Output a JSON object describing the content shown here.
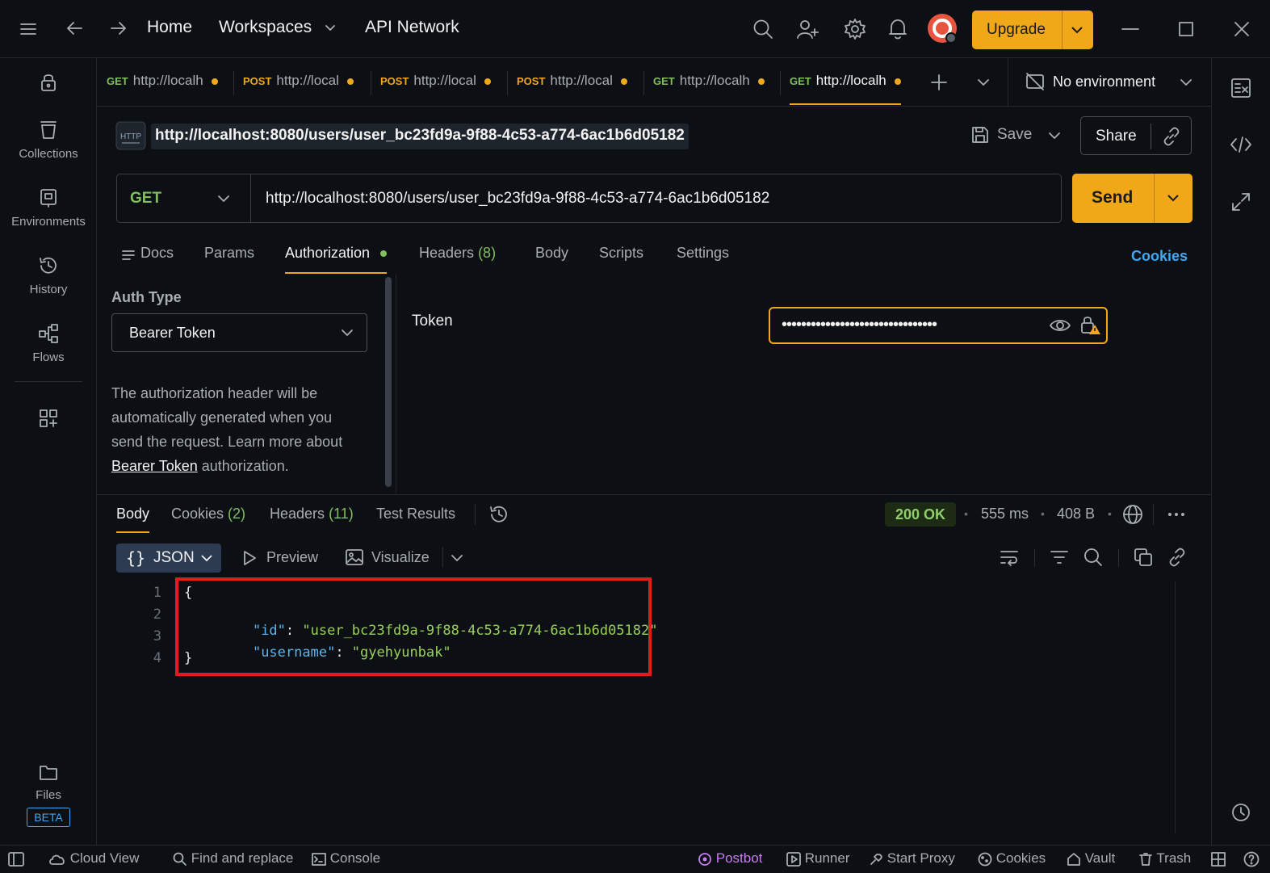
{
  "titlebar": {
    "home": "Home",
    "workspaces": "Workspaces",
    "api_network": "API Network",
    "upgrade": "Upgrade"
  },
  "sidebar": {
    "items": [
      {
        "label": "Collections"
      },
      {
        "label": "Environments"
      },
      {
        "label": "History"
      },
      {
        "label": "Flows"
      }
    ],
    "files": "Files",
    "beta": "BETA"
  },
  "tabs": [
    {
      "method": "GET",
      "url": "http://localh"
    },
    {
      "method": "POST",
      "url": "http://local"
    },
    {
      "method": "POST",
      "url": "http://local"
    },
    {
      "method": "POST",
      "url": "http://local"
    },
    {
      "method": "GET",
      "url": "http://localh"
    },
    {
      "method": "GET",
      "url": "http://localh"
    }
  ],
  "environment": "No environment",
  "request": {
    "name": "http://localhost:8080/users/user_bc23fd9a-9f88-4c53-a774-6ac1b6d05182",
    "save": "Save",
    "share": "Share",
    "method": "GET",
    "url": "http://localhost:8080/users/user_bc23fd9a-9f88-4c53-a774-6ac1b6d05182",
    "send": "Send",
    "tabs": {
      "docs": "Docs",
      "params": "Params",
      "authorization": "Authorization",
      "headers": "Headers",
      "headers_count": "(8)",
      "body": "Body",
      "scripts": "Scripts",
      "settings": "Settings"
    },
    "cookies": "Cookies"
  },
  "auth": {
    "type_label": "Auth Type",
    "type_value": "Bearer Token",
    "help_line1": "The authorization header will be",
    "help_line2": "automatically generated when you",
    "help_line3": "send the request. Learn more about",
    "help_link": "Bearer Token",
    "help_tail": " authorization.",
    "token_label": "Token",
    "token_masked": "••••••••••••••••••••••••••••••••"
  },
  "response": {
    "tabs": {
      "body": "Body",
      "cookies": "Cookies",
      "cookies_count": "(2)",
      "headers": "Headers",
      "headers_count": "(11)",
      "test_results": "Test Results"
    },
    "status": "200 OK",
    "time": "555 ms",
    "size": "408 B",
    "format": "JSON",
    "preview": "Preview",
    "visualize": "Visualize",
    "lines": [
      {
        "n": "1",
        "text": "{"
      },
      {
        "n": "2",
        "key": "\"id\"",
        "value": "\"user_bc23fd9a-9f88-4c53-a774-6ac1b6d05182\""
      },
      {
        "n": "3",
        "key": "\"username\"",
        "value": "\"gyehyunbak\""
      },
      {
        "n": "4",
        "text": "}"
      }
    ]
  },
  "statusbar": {
    "cloud_view": "Cloud View",
    "find_replace": "Find and replace",
    "console": "Console",
    "postbot": "Postbot",
    "runner": "Runner",
    "start_proxy": "Start Proxy",
    "cookies": "Cookies",
    "vault": "Vault",
    "trash": "Trash"
  },
  "colors": {
    "accent": "#f0a818",
    "get": "#7fc05b",
    "post": "#f0a818",
    "json_key": "#5fb3e8",
    "json_string": "#9ad05a",
    "highlight_box": "#e01c1c",
    "link": "#3fa9f5",
    "postbot": "#c97cf0"
  }
}
